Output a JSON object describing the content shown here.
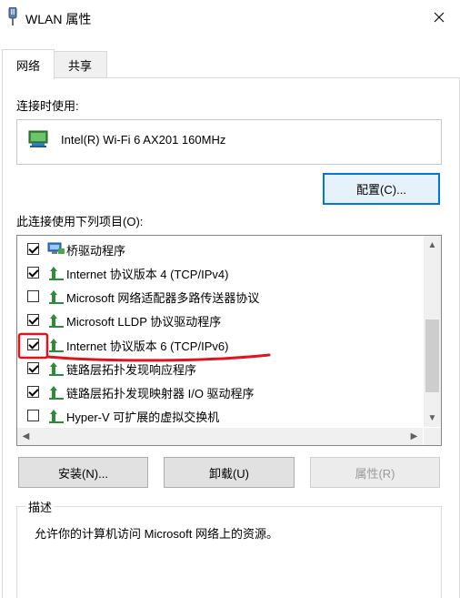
{
  "window": {
    "title": "WLAN 属性"
  },
  "tabs": [
    {
      "label": "网络"
    },
    {
      "label": "共享"
    }
  ],
  "connect_using": {
    "label": "连接时使用:",
    "adapter": "Intel(R) Wi-Fi 6 AX201 160MHz",
    "configure_button": "配置(C)..."
  },
  "items_section": {
    "label": "此连接使用下列项目(O):",
    "items": [
      {
        "label": "桥驱动程序",
        "checked": true,
        "icon": "bridge-icon"
      },
      {
        "label": "Internet 协议版本 4 (TCP/IPv4)",
        "checked": true,
        "icon": "protocol-icon"
      },
      {
        "label": "Microsoft 网络适配器多路传送器协议",
        "checked": false,
        "icon": "protocol-icon"
      },
      {
        "label": "Microsoft LLDP 协议驱动程序",
        "checked": true,
        "icon": "protocol-icon"
      },
      {
        "label": "Internet 协议版本 6 (TCP/IPv6)",
        "checked": true,
        "icon": "protocol-icon"
      },
      {
        "label": "链路层拓扑发现响应程序",
        "checked": true,
        "icon": "protocol-icon"
      },
      {
        "label": "链路层拓扑发现映射器 I/O 驱动程序",
        "checked": true,
        "icon": "protocol-icon"
      },
      {
        "label": "Hyper-V 可扩展的虚拟交换机",
        "checked": false,
        "icon": "protocol-icon"
      }
    ]
  },
  "buttons": {
    "install": "安装(N)...",
    "uninstall": "卸载(U)",
    "properties": "属性(R)"
  },
  "description": {
    "title": "描述",
    "text": "允许你的计算机访问 Microsoft 网络上的资源。"
  },
  "colors": {
    "accent": "#0078d7",
    "annotation_red": "#e0141e",
    "protocol_green": "#2e8b3a"
  }
}
